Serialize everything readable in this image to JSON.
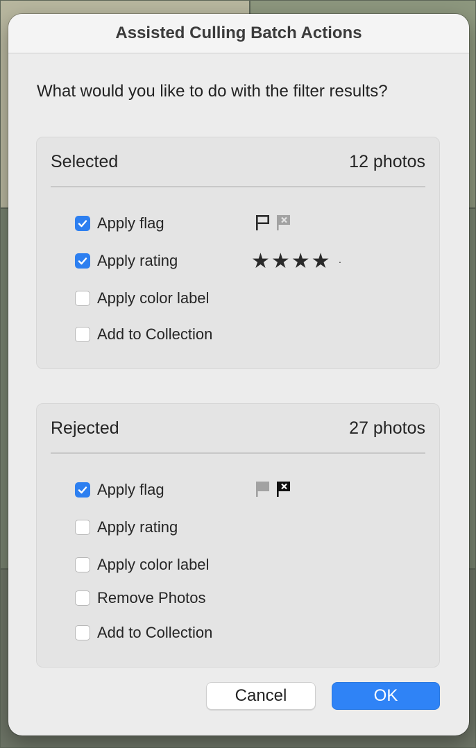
{
  "dialog": {
    "title": "Assisted Culling Batch Actions",
    "question": "What would you like to do with the filter results?",
    "accent_color": "#2d7ff0"
  },
  "selected": {
    "heading": "Selected",
    "count": "12 photos",
    "options": [
      {
        "label": "Apply flag",
        "checked": true
      },
      {
        "label": "Apply rating",
        "checked": true
      },
      {
        "label": "Apply color label",
        "checked": false
      },
      {
        "label": "Add to Collection",
        "checked": false
      }
    ],
    "flag_icons": [
      "pick-flag-icon",
      "reject-flag-icon"
    ],
    "flag_active": "pick",
    "rating": {
      "stars": 4,
      "glyph": "★★★★",
      "empty_marker": "·"
    }
  },
  "rejected": {
    "heading": "Rejected",
    "count": "27 photos",
    "options": [
      {
        "label": "Apply flag",
        "checked": true
      },
      {
        "label": "Apply rating",
        "checked": false
      },
      {
        "label": "Apply color label",
        "checked": false
      },
      {
        "label": "Remove Photos",
        "checked": false
      },
      {
        "label": "Add to Collection",
        "checked": false
      }
    ],
    "flag_icons": [
      "pick-flag-icon",
      "reject-flag-icon"
    ],
    "flag_active": "reject"
  },
  "buttons": {
    "cancel": "Cancel",
    "ok": "OK"
  }
}
